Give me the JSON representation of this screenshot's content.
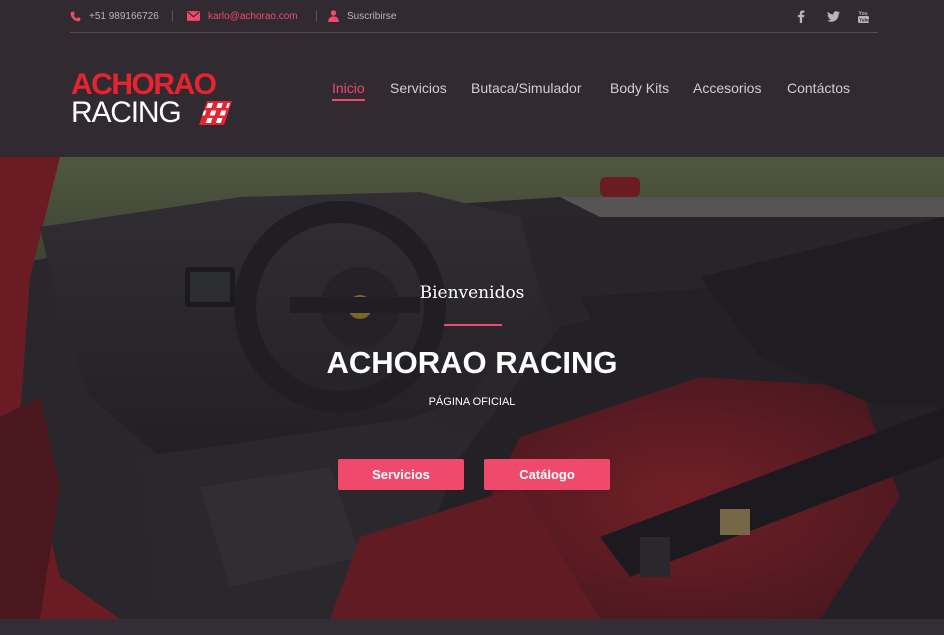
{
  "topbar": {
    "phone": "+51 989166726",
    "email": "karlo@achorao.com",
    "subscribe": "Suscribirse",
    "social_icons": [
      "facebook-icon",
      "twitter-icon",
      "youtube-icon"
    ]
  },
  "logo": {
    "line1": "ACHORAO",
    "line2": "RACING"
  },
  "nav": {
    "items": [
      {
        "label": "Inicio",
        "active": true
      },
      {
        "label": "Servicios",
        "active": false
      },
      {
        "label": "Butaca/Simulador",
        "active": false
      },
      {
        "label": "Body Kits",
        "active": false
      },
      {
        "label": "Accesorios",
        "active": false
      },
      {
        "label": "Contáctos",
        "active": false
      }
    ]
  },
  "hero": {
    "welcome": "Bienvenidos",
    "title": "ACHORAO RACING",
    "subtitle": "PÁGINA OFICIAL",
    "buttons": [
      {
        "label": "Servicios"
      },
      {
        "label": "Catálogo"
      }
    ]
  },
  "colors": {
    "accent": "#f0496b",
    "header_bg": "#312a31",
    "logo_red": "#e5242f"
  }
}
